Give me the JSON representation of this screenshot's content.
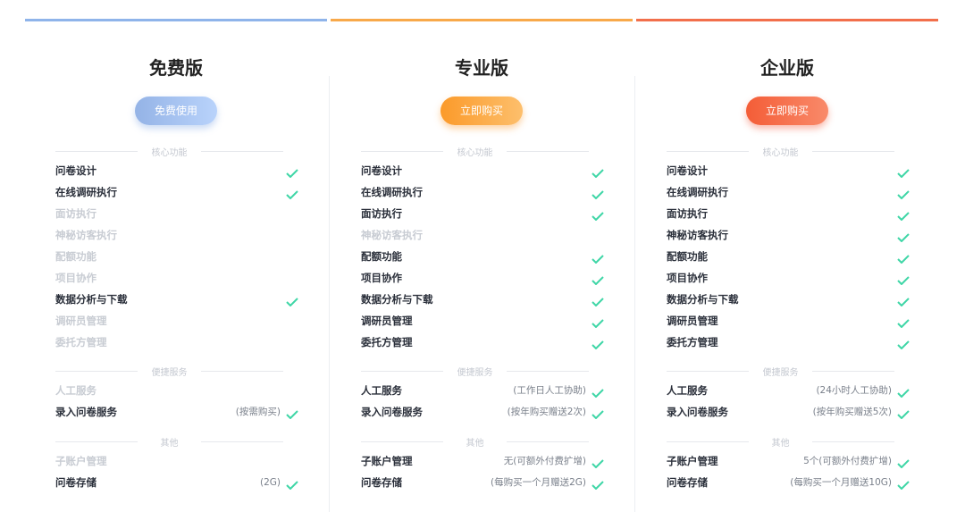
{
  "colors": {
    "free": "#8fb4ea",
    "pro": "#f8a94a",
    "ent": "#f26f4b",
    "check": "#3ed6a6"
  },
  "plans": [
    {
      "title": "免费版",
      "button": "免费使用",
      "sections": [
        {
          "name": "核心功能",
          "rows": [
            {
              "label": "问卷设计",
              "on": true,
              "note": ""
            },
            {
              "label": "在线调研执行",
              "on": true,
              "note": ""
            },
            {
              "label": "面访执行",
              "on": false,
              "note": ""
            },
            {
              "label": "神秘访客执行",
              "on": false,
              "note": ""
            },
            {
              "label": "配额功能",
              "on": false,
              "note": ""
            },
            {
              "label": "项目协作",
              "on": false,
              "note": ""
            },
            {
              "label": "数据分析与下载",
              "on": true,
              "note": ""
            },
            {
              "label": "调研员管理",
              "on": false,
              "note": ""
            },
            {
              "label": "委托方管理",
              "on": false,
              "note": ""
            }
          ]
        },
        {
          "name": "便捷服务",
          "rows": [
            {
              "label": "人工服务",
              "on": false,
              "note": ""
            },
            {
              "label": "录入问卷服务",
              "on": true,
              "note": "(按需购买)"
            }
          ]
        },
        {
          "name": "其他",
          "rows": [
            {
              "label": "子账户管理",
              "on": false,
              "note": ""
            },
            {
              "label": "问卷存储",
              "on": true,
              "note": "(2G)"
            }
          ]
        }
      ]
    },
    {
      "title": "专业版",
      "button": "立即购买",
      "sections": [
        {
          "name": "核心功能",
          "rows": [
            {
              "label": "问卷设计",
              "on": true,
              "note": ""
            },
            {
              "label": "在线调研执行",
              "on": true,
              "note": ""
            },
            {
              "label": "面访执行",
              "on": true,
              "note": ""
            },
            {
              "label": "神秘访客执行",
              "on": false,
              "note": ""
            },
            {
              "label": "配额功能",
              "on": true,
              "note": ""
            },
            {
              "label": "项目协作",
              "on": true,
              "note": ""
            },
            {
              "label": "数据分析与下载",
              "on": true,
              "note": ""
            },
            {
              "label": "调研员管理",
              "on": true,
              "note": ""
            },
            {
              "label": "委托方管理",
              "on": true,
              "note": ""
            }
          ]
        },
        {
          "name": "便捷服务",
          "rows": [
            {
              "label": "人工服务",
              "on": true,
              "note": "(工作日人工协助)"
            },
            {
              "label": "录入问卷服务",
              "on": true,
              "note": "(按年购买赠送2次)"
            }
          ]
        },
        {
          "name": "其他",
          "rows": [
            {
              "label": "子账户管理",
              "on": true,
              "note": "无(可额外付费扩增)"
            },
            {
              "label": "问卷存储",
              "on": true,
              "note": "(每购买一个月赠送2G)"
            }
          ]
        }
      ]
    },
    {
      "title": "企业版",
      "button": "立即购买",
      "sections": [
        {
          "name": "核心功能",
          "rows": [
            {
              "label": "问卷设计",
              "on": true,
              "note": ""
            },
            {
              "label": "在线调研执行",
              "on": true,
              "note": ""
            },
            {
              "label": "面访执行",
              "on": true,
              "note": ""
            },
            {
              "label": "神秘访客执行",
              "on": true,
              "note": ""
            },
            {
              "label": "配额功能",
              "on": true,
              "note": ""
            },
            {
              "label": "项目协作",
              "on": true,
              "note": ""
            },
            {
              "label": "数据分析与下载",
              "on": true,
              "note": ""
            },
            {
              "label": "调研员管理",
              "on": true,
              "note": ""
            },
            {
              "label": "委托方管理",
              "on": true,
              "note": ""
            }
          ]
        },
        {
          "name": "便捷服务",
          "rows": [
            {
              "label": "人工服务",
              "on": true,
              "note": "(24小时人工协助)"
            },
            {
              "label": "录入问卷服务",
              "on": true,
              "note": "(按年购买赠送5次)"
            }
          ]
        },
        {
          "name": "其他",
          "rows": [
            {
              "label": "子账户管理",
              "on": true,
              "note": "5个(可额外付费扩增)"
            },
            {
              "label": "问卷存储",
              "on": true,
              "note": "(每购买一个月赠送10G)"
            }
          ]
        }
      ]
    }
  ]
}
